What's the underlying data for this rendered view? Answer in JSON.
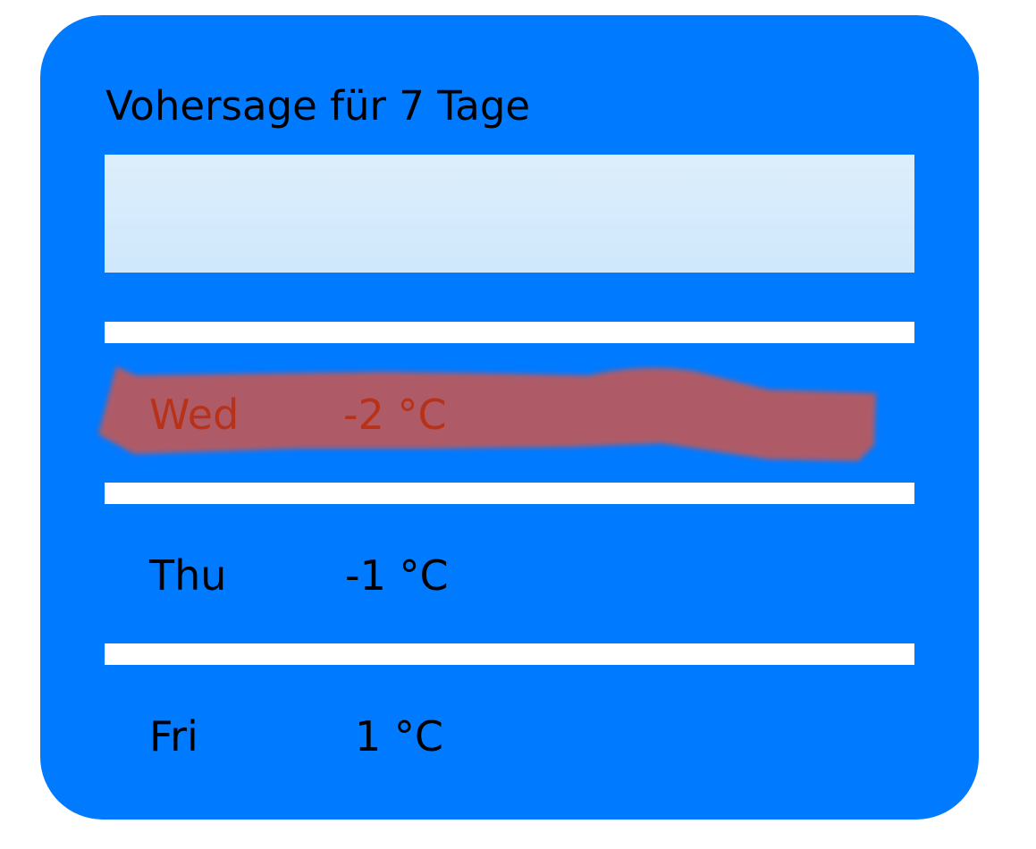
{
  "widget": {
    "title": "Vohersage für 7 Tage",
    "colors": {
      "card_background": "#007aff",
      "banner_background": "#d6ebfb",
      "divider": "#ffffff",
      "text": "#000000",
      "highlight_text": "#b73219",
      "highlight_mark": "#b75a5f"
    },
    "forecast": [
      {
        "day": "Wed",
        "temp": "-2 °C",
        "highlighted": true
      },
      {
        "day": "Thu",
        "temp": "-1 °C",
        "highlighted": false
      },
      {
        "day": "Fri",
        "temp": "1 °C",
        "highlighted": false
      }
    ]
  }
}
